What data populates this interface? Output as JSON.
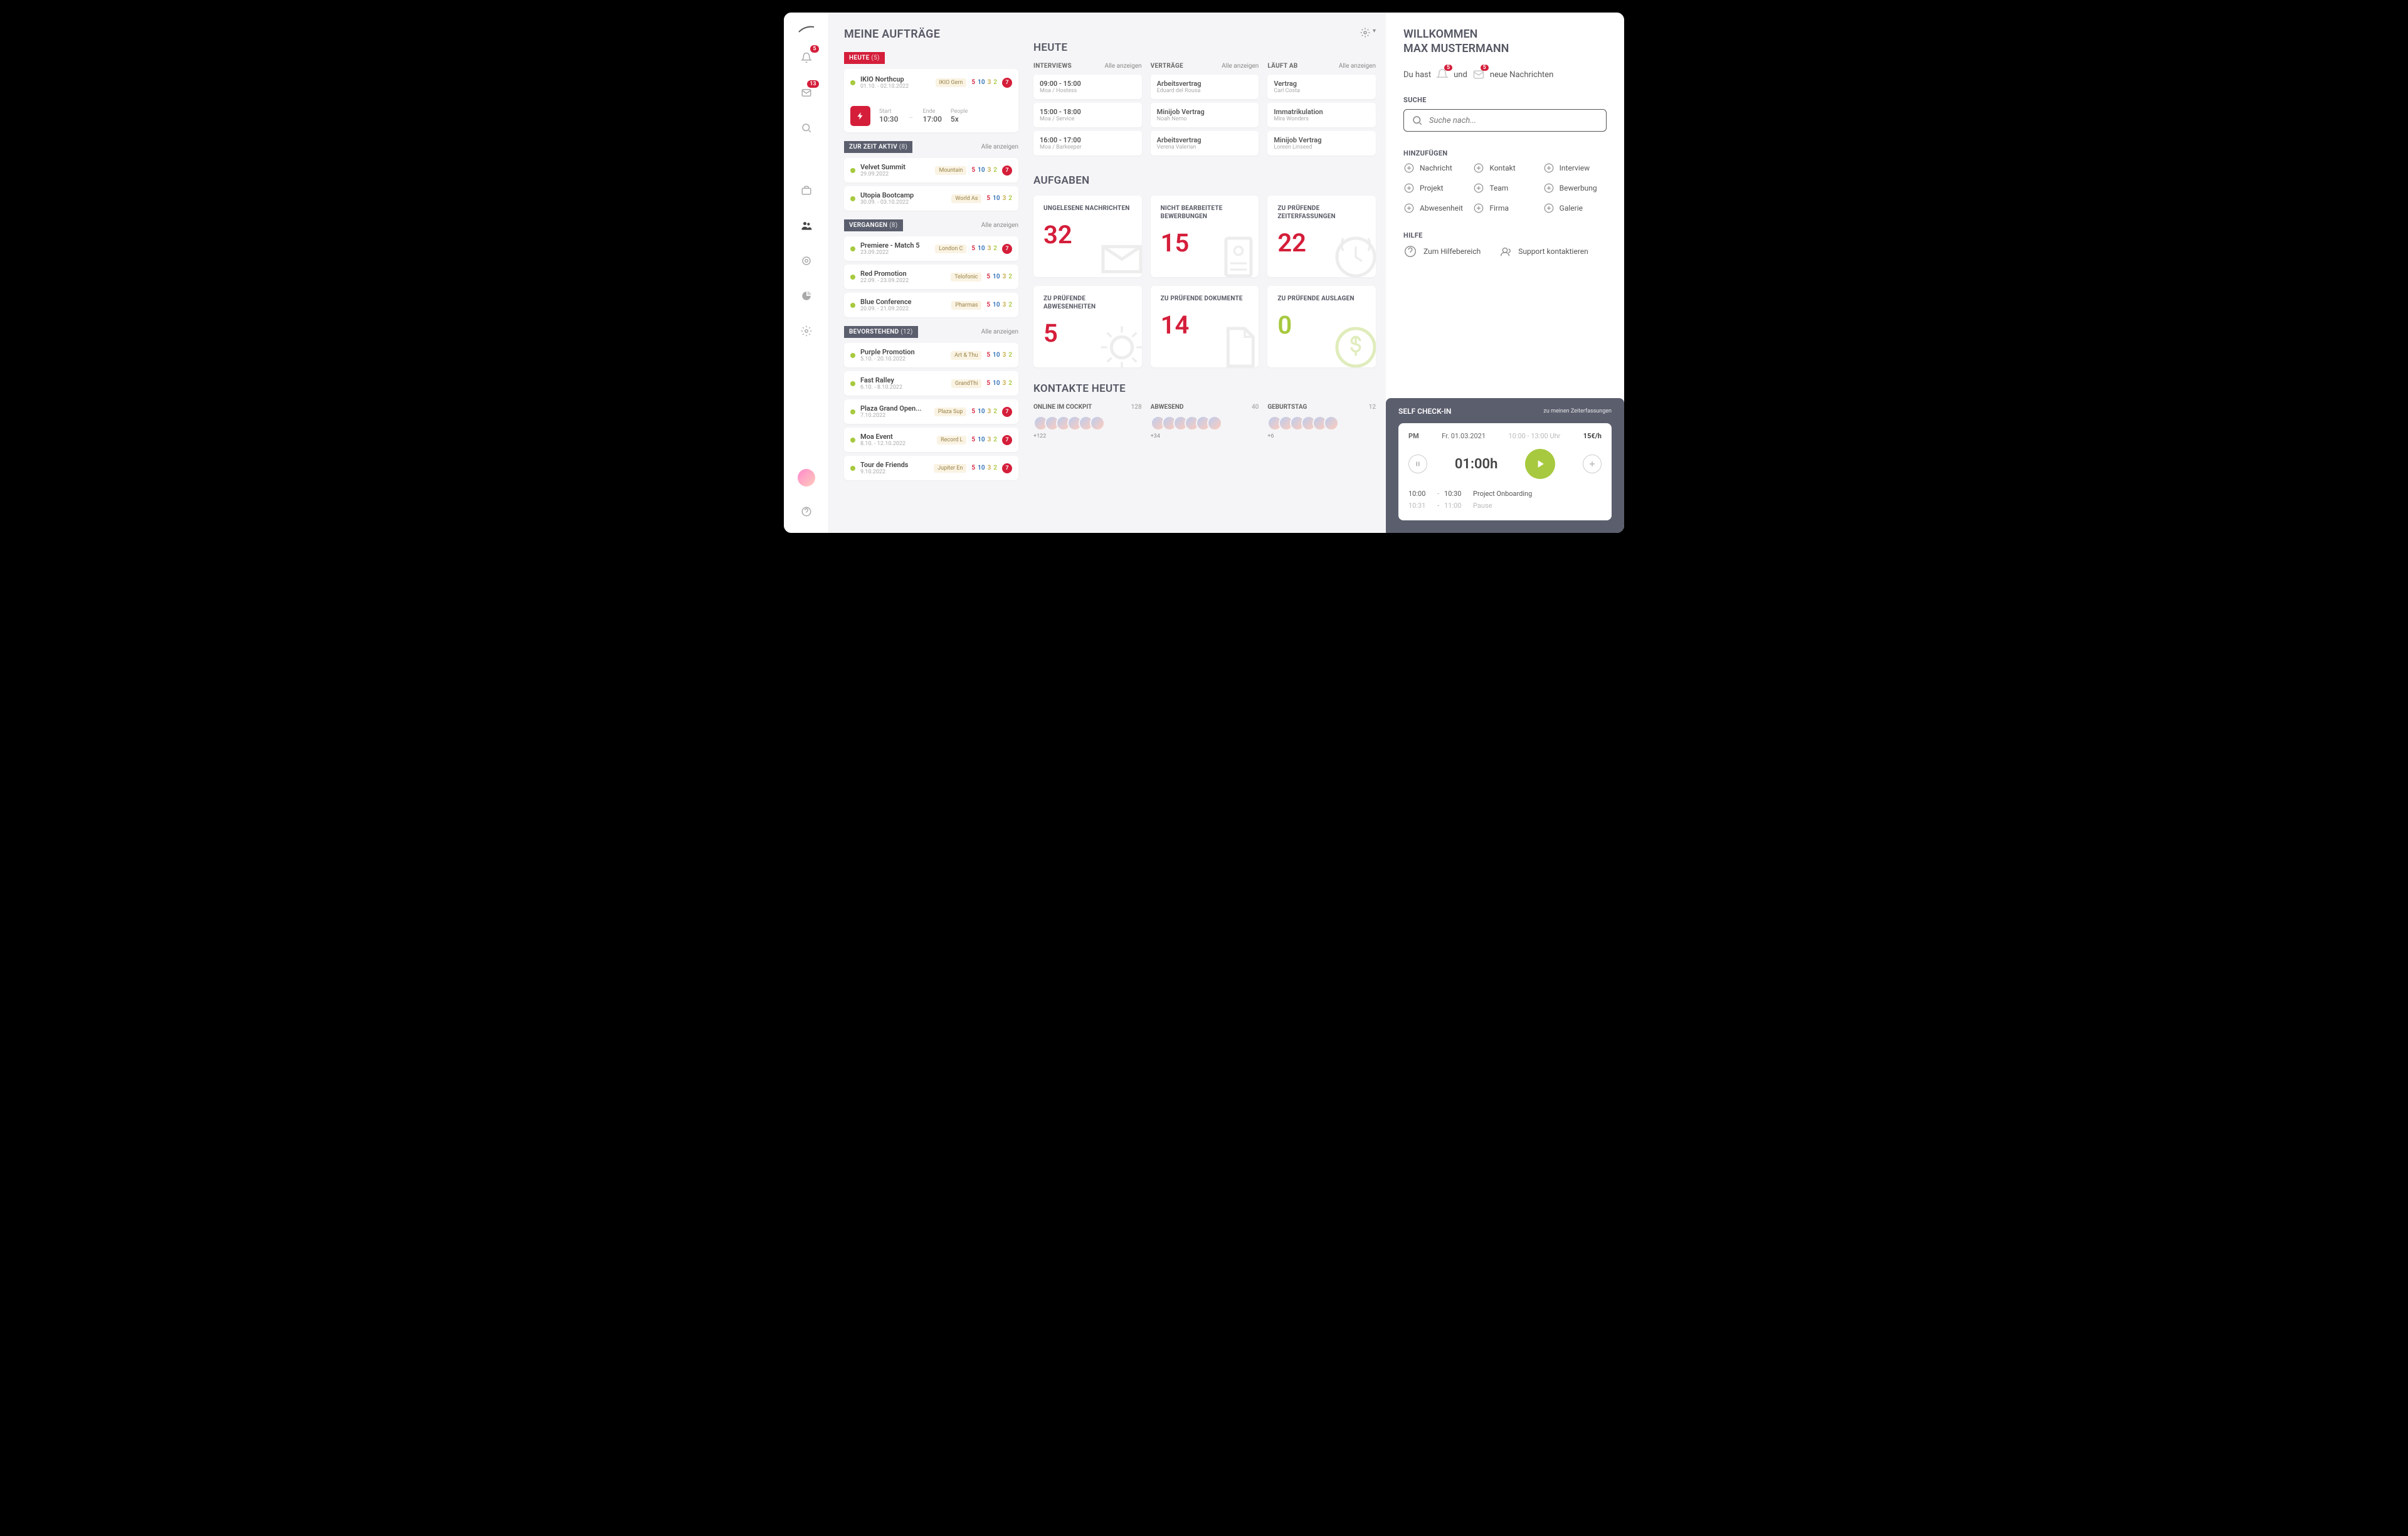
{
  "sidebar": {
    "bell_badge": "5",
    "mail_badge": "13"
  },
  "auftrage": {
    "title": "MEINE AUFTRÄGE",
    "heute": {
      "label": "HEUTE",
      "count": "(5)",
      "featured": {
        "title": "IKIO Northcup",
        "date": "01.10. - 02.10.2022",
        "chip": "IKIO Gern",
        "n1": "5",
        "n2": "10",
        "n3": "3",
        "n4": "2",
        "circ": "7",
        "start_lbl": "Start",
        "start": "10:30",
        "end_lbl": "Ende",
        "end": "17:00",
        "ppl_lbl": "People",
        "ppl": "5x"
      }
    },
    "aktiv": {
      "label": "ZUR ZEIT AKTIV",
      "count": "(8)",
      "show_all": "Alle anzeigen",
      "items": [
        {
          "title": "Velvet Summit",
          "date": "29.09.2022",
          "chip": "Mountain",
          "n1": "5",
          "n2": "10",
          "n3": "3",
          "n4": "2",
          "circ": "7"
        },
        {
          "title": "Utopia Bootcamp",
          "date": "30.09. - 03.10.2022",
          "chip": "World As",
          "n1": "5",
          "n2": "10",
          "n3": "3",
          "n4": "2"
        }
      ]
    },
    "vergangen": {
      "label": "VERGANGEN",
      "count": "(8)",
      "show_all": "Alle anzeigen",
      "items": [
        {
          "title": "Premiere - Match 5",
          "date": "23.09.2022",
          "chip": "London C",
          "n1": "5",
          "n2": "10",
          "n3": "3",
          "n4": "2",
          "circ": "7"
        },
        {
          "title": "Red Promotion",
          "date": "22.09. - 23.09.2022",
          "chip": "Telofonic",
          "n1": "5",
          "n2": "10",
          "n3": "3",
          "n4": "2"
        },
        {
          "title": "Blue Conference",
          "date": "20.09. - 21.09.2022",
          "chip": "Pharmas",
          "n1": "5",
          "n2": "10",
          "n3": "3",
          "n4": "2"
        }
      ]
    },
    "bevorstehend": {
      "label": "BEVORSTEHEND",
      "count": "(12)",
      "show_all": "Alle anzeigen",
      "items": [
        {
          "title": "Purple Promotion",
          "date": "5.10. - 20.10.2022",
          "chip": "Art & Thu",
          "n1": "5",
          "n2": "10",
          "n3": "3",
          "n4": "2"
        },
        {
          "title": "Fast Ralley",
          "date": "6.10. - 8.10.2022",
          "chip": "GrandThi",
          "n1": "5",
          "n2": "10",
          "n3": "3",
          "n4": "2"
        },
        {
          "title": "Plaza Grand Open...",
          "date": "7.10.2022",
          "chip": "Plaza Sup",
          "n1": "5",
          "n2": "10",
          "n3": "3",
          "n4": "2",
          "circ": "7"
        },
        {
          "title": "Moa Event",
          "date": "8.10. - 12.10.2022",
          "chip": "Record L",
          "n1": "5",
          "n2": "10",
          "n3": "3",
          "n4": "2",
          "circ": "7"
        },
        {
          "title": "Tour de Friends",
          "date": "9.10.2022",
          "chip": "Jupiter En",
          "n1": "5",
          "n2": "10",
          "n3": "3",
          "n4": "2",
          "circ": "7"
        }
      ]
    }
  },
  "heute": {
    "title": "HEUTE",
    "cols": [
      {
        "title": "INTERVIEWS",
        "show_all": "Alle anzeigen",
        "items": [
          {
            "l1": "09:00 - 15:00",
            "l2": "Moa / Hostess"
          },
          {
            "l1": "15:00 - 18:00",
            "l2": "Moa / Service"
          },
          {
            "l1": "16:00 - 17:00",
            "l2": "Moa / Barkeeper"
          }
        ]
      },
      {
        "title": "VERTRÄGE",
        "show_all": "Alle anzeigen",
        "items": [
          {
            "l1": "Arbeitsvertrag",
            "l2": "Eduard del Rousa"
          },
          {
            "l1": "Minijob Vertrag",
            "l2": "Noah Nemo"
          },
          {
            "l1": "Arbeitsvertrag",
            "l2": "Verena Valerian"
          }
        ]
      },
      {
        "title": "LÄUFT AB",
        "show_all": "Alle anzeigen",
        "items": [
          {
            "l1": "Vertrag",
            "l2": "Carl Costa"
          },
          {
            "l1": "Immatrikulation",
            "l2": "Mira Wonders"
          },
          {
            "l1": "Minijob Vertrag",
            "l2": "Loreen Linseed"
          }
        ]
      }
    ]
  },
  "aufgaben": {
    "title": "AUFGABEN",
    "cards": [
      {
        "title": "UNGELESENE NACHRICHTEN",
        "num": "32"
      },
      {
        "title": "NICHT BEARBEITETE BEWERBUNGEN",
        "num": "15"
      },
      {
        "title": "ZU PRÜFENDE ZEITERFASSUNGEN",
        "num": "22"
      },
      {
        "title": "ZU PRÜFENDE ABWESENHEITEN",
        "num": "5"
      },
      {
        "title": "ZU PRÜFENDE DOKUMENTE",
        "num": "14"
      },
      {
        "title": "ZU PRÜFENDE AUSLAGEN",
        "num": "0",
        "green": true
      }
    ]
  },
  "kontakte": {
    "title": "KONTAKTE HEUTE",
    "cols": [
      {
        "title": "ONLINE IM COCKPIT",
        "count": "128",
        "more": "+122"
      },
      {
        "title": "ABWESEND",
        "count": "40",
        "more": "+34"
      },
      {
        "title": "GEBURTSTAG",
        "count": "12",
        "more": "+6"
      }
    ]
  },
  "right": {
    "welcome1": "WILLKOMMEN",
    "welcome2": "MAX MUSTERMANN",
    "msg_pre": "Du hast",
    "msg_badge1": "5",
    "msg_mid": "und",
    "msg_badge2": "5",
    "msg_post": "neue Nachrichten",
    "search_lbl": "SUCHE",
    "search_ph": "Suche nach...",
    "add_lbl": "HINZUFÜGEN",
    "add_items": [
      "Nachricht",
      "Kontakt",
      "Interview",
      "Projekt",
      "Team",
      "Bewerbung",
      "Abwesenheit",
      "Firma",
      "Galerie"
    ],
    "help_lbl": "HILFE",
    "help1": "Zum Hilfebereich",
    "help2": "Support kontaktieren"
  },
  "checkin": {
    "title": "SELF CHECK-IN",
    "link": "zu meinen Zeiterfassungen",
    "pm": "PM",
    "date": "Fr. 01.03.2021",
    "hours": "10:00  -  13:00 Uhr",
    "rate": "15€/h",
    "elapsed": "01:00h",
    "rows": [
      {
        "t1": "10:00",
        "t2": "10:30",
        "label": "Project Onboarding"
      },
      {
        "t1": "10:31",
        "t2": "11:00",
        "label": "Pause",
        "dim": true
      }
    ]
  }
}
